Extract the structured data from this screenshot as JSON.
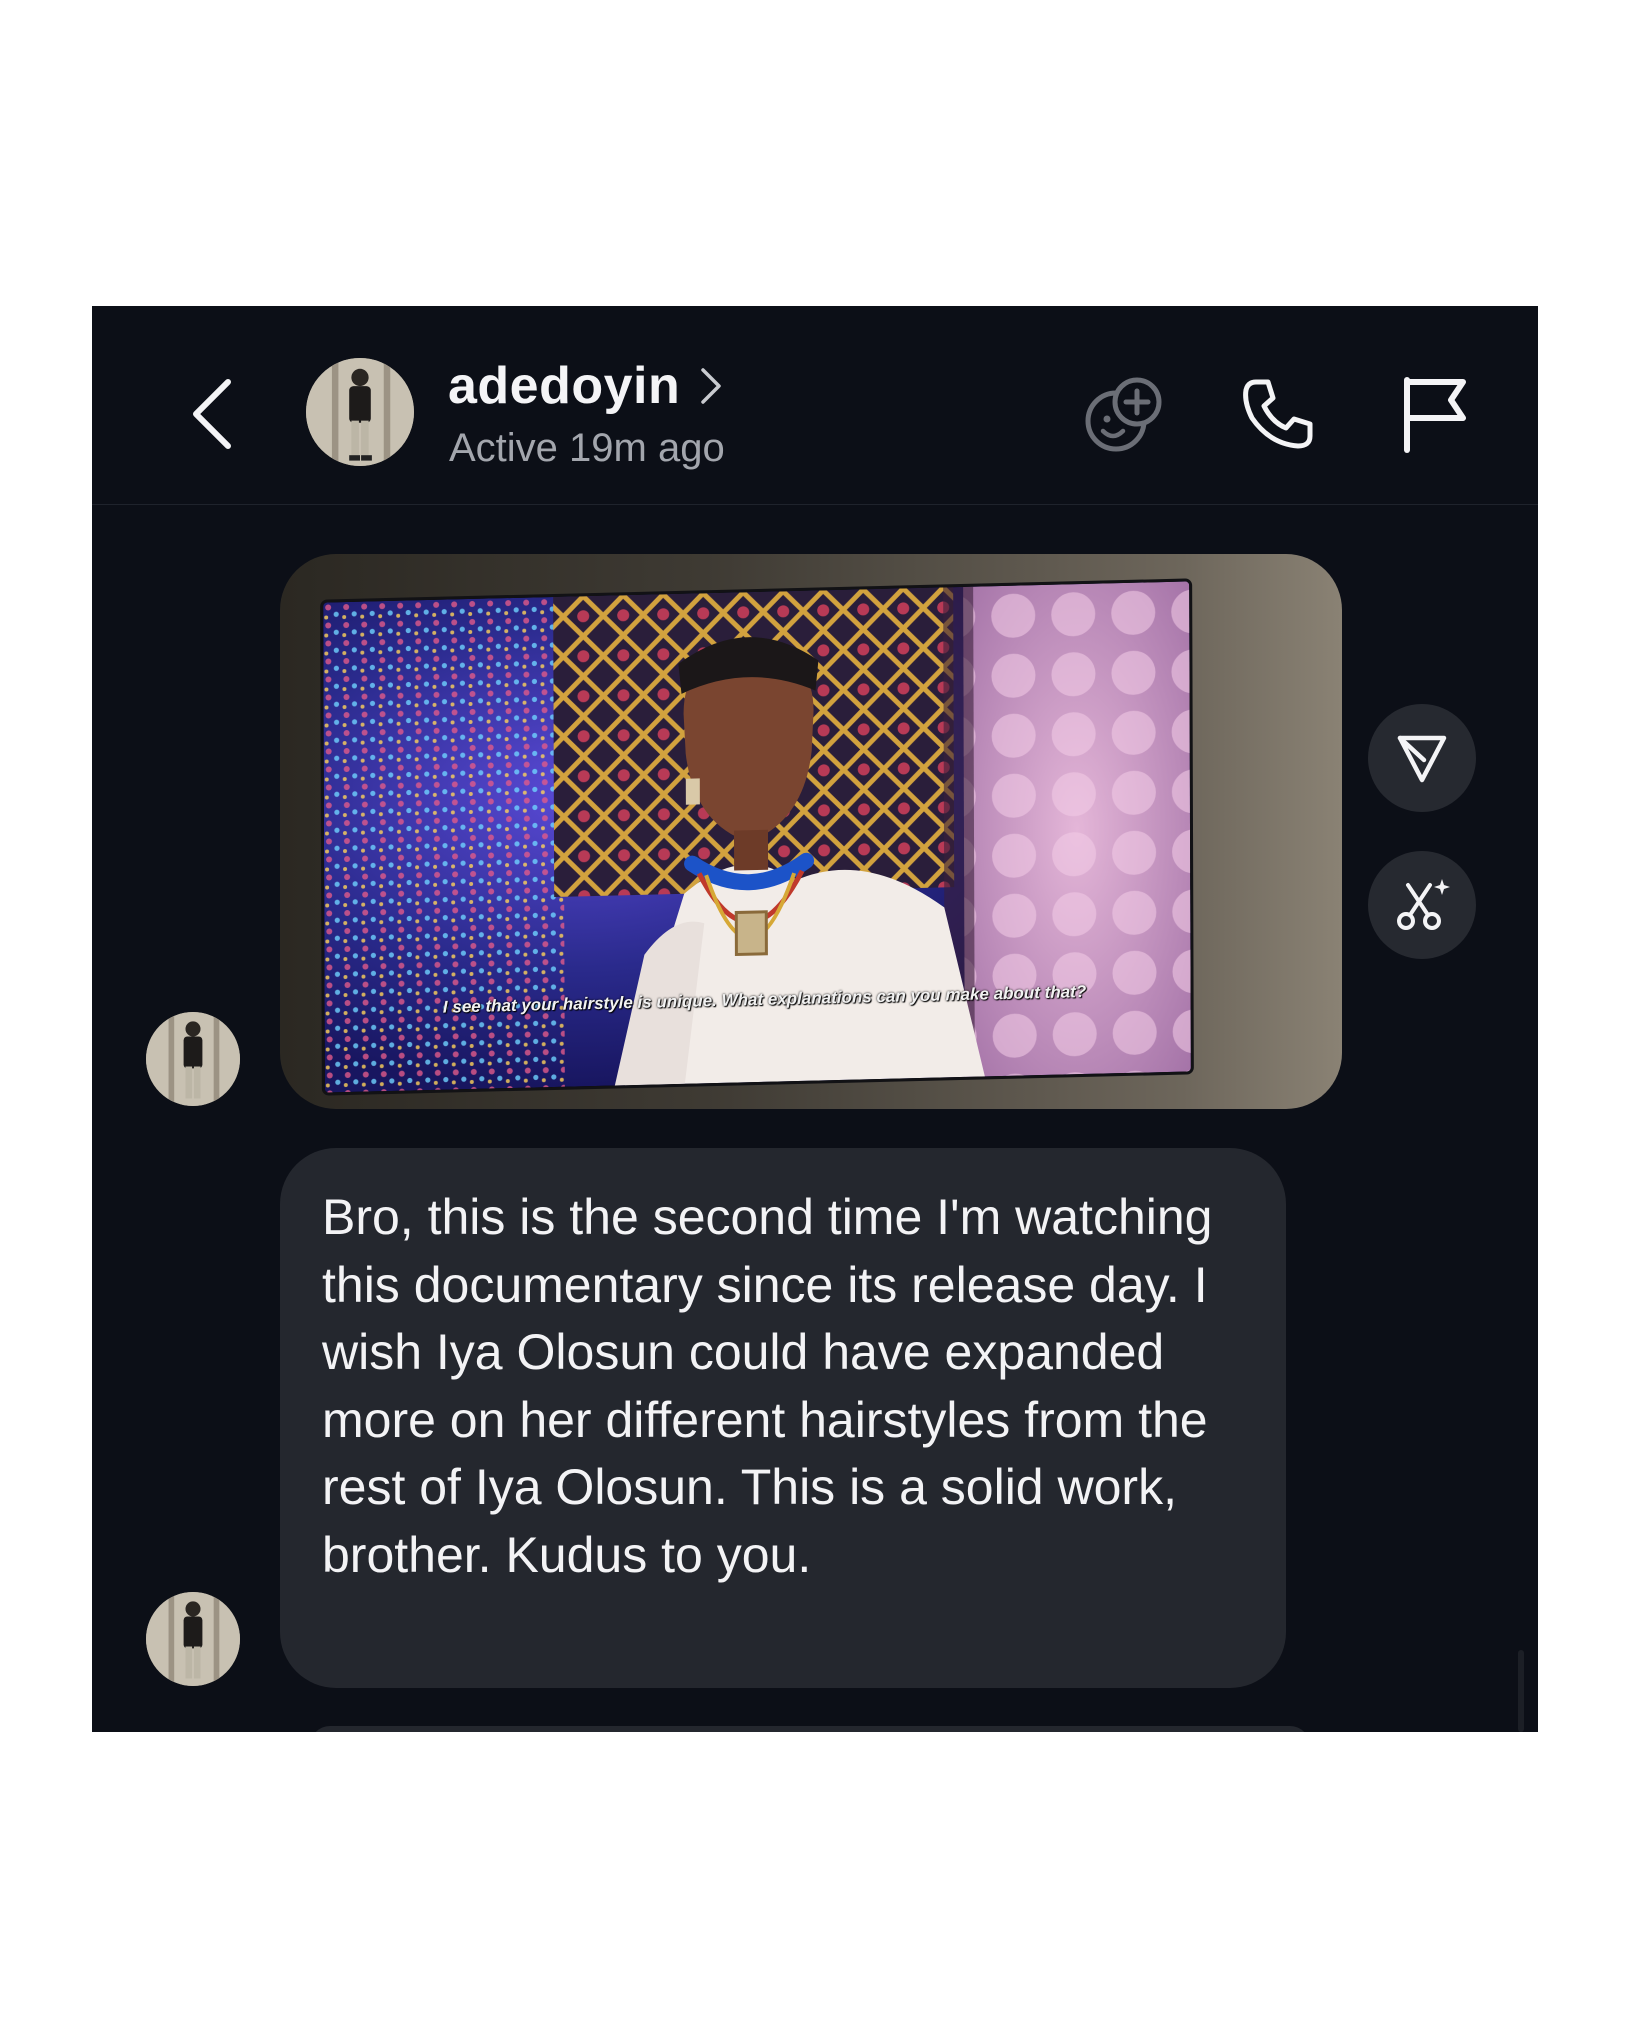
{
  "header": {
    "username": "adedoyin",
    "status": "Active 19m ago"
  },
  "icons": {
    "back": "chevron-left-icon",
    "profile": "chevron-right-icon",
    "effects": "effects-icon",
    "call": "phone-icon",
    "report": "flag-icon",
    "share": "send-icon",
    "remix": "remix-icon"
  },
  "message_photo": {
    "subtitle": "I see that your hairstyle is unique. What explanations can you make about that?"
  },
  "message_text": {
    "body": "Bro, this is the second time I'm watching this documentary since its release day. I wish Iya Olosun could have expanded more on her different hairstyles from the rest of Iya Olosun. This is a solid work, brother. Kudus to you."
  },
  "colors": {
    "background": "#0c0f17",
    "bubble": "#24272e",
    "text": "#f3f3f5",
    "secondary_text": "#a3a6ad"
  }
}
